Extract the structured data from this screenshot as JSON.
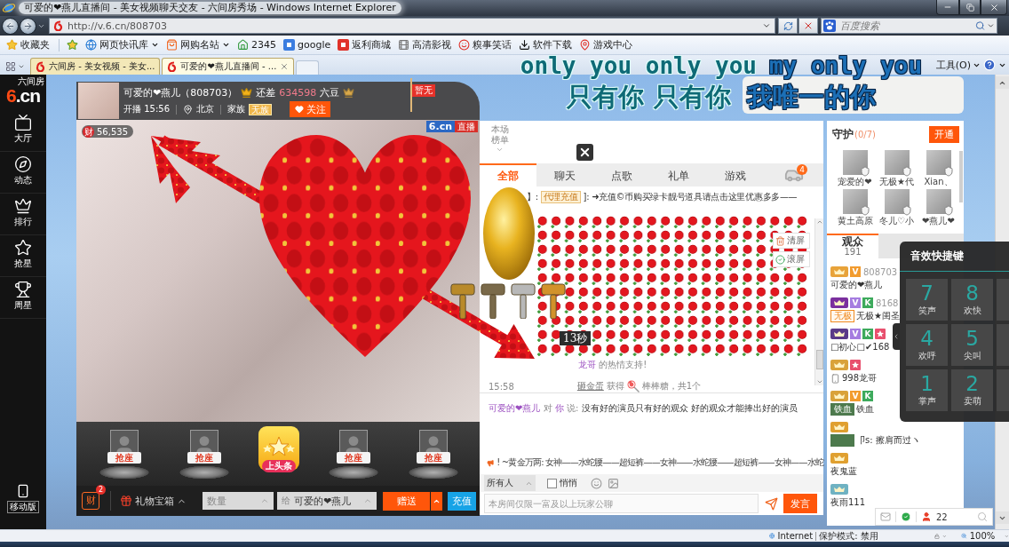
{
  "window": {
    "title": "可爱的❤燕儿直播间 - 美女视频聊天交友 - 六间房秀场 - Windows Internet Explorer"
  },
  "address_bar": {
    "url": "http://v.6.cn/808703"
  },
  "search_box": {
    "placeholder": "百度搜索"
  },
  "favorites_button": "收藏夹",
  "favorites": [
    {
      "label": "网页快讯库",
      "menu": true
    },
    {
      "label": "网购名站",
      "menu": true
    },
    {
      "label": "2345",
      "menu": false
    },
    {
      "label": "google",
      "menu": false
    },
    {
      "label": "返利商城",
      "menu": false
    },
    {
      "label": "高清影视",
      "menu": false
    },
    {
      "label": "糗事笑话",
      "menu": false
    },
    {
      "label": "软件下载",
      "menu": false
    },
    {
      "label": "游戏中心",
      "menu": false
    }
  ],
  "browser_tabs": [
    {
      "title": "六间房 - 美女视频 - 美女...",
      "selected": false
    },
    {
      "title": "可爱的❤燕儿直播间 - ...",
      "selected": true
    }
  ],
  "command_bar": {
    "tools": "工具(O)"
  },
  "lyrics": [
    {
      "parts": [
        {
          "text": "only you only you",
          "highlighted": false
        },
        {
          "text": "my only you",
          "highlighted": true
        }
      ]
    },
    {
      "parts": [
        {
          "text": "只有你 只有你",
          "highlighted": false
        },
        {
          "text": "我唯一的你",
          "highlighted": true
        }
      ]
    }
  ],
  "sidebar": {
    "logo": "6.cn",
    "logo_caption": "六间房",
    "items": [
      {
        "label": "大厅"
      },
      {
        "label": "动态"
      },
      {
        "label": "排行"
      },
      {
        "label": "抢星"
      },
      {
        "label": "周星"
      }
    ],
    "mobile": "移动版"
  },
  "anchor": {
    "name": "可爱的❤燕儿（808703）",
    "gap_label": "还差",
    "gap_value": "634598",
    "gap_unit": "六豆",
    "start": "开播 15:56",
    "city": "北京",
    "family_label": "家族",
    "family_tag": "无族",
    "follow": "关注",
    "flag": "暂无"
  },
  "video": {
    "wealth_mark": "财",
    "wealth": "56,535",
    "brand": "6.cn",
    "status": "直播"
  },
  "seats": [
    {
      "kind": "seat",
      "label": "抢座"
    },
    {
      "kind": "seat",
      "label": "抢座"
    },
    {
      "kind": "headline",
      "label": "上头条"
    },
    {
      "kind": "seat",
      "label": "抢座"
    },
    {
      "kind": "seat",
      "label": "抢座"
    }
  ],
  "gift_bar": {
    "wealth_mark": "财",
    "wealth_badge": "2",
    "gift_box": "礼物宝箱",
    "quantity_placeholder": "数量",
    "recipient_label": "给",
    "recipient": "可爱的❤燕儿",
    "send": "赠送",
    "recharge": "充值"
  },
  "gift_effect": {
    "countdown": "13秒"
  },
  "chat": {
    "ranking": "本场榜单",
    "tabs": [
      {
        "label": "全部",
        "selected": true
      },
      {
        "label": "聊天",
        "selected": false
      },
      {
        "label": "点歌",
        "selected": false
      },
      {
        "label": "礼单",
        "selected": false
      },
      {
        "label": "游戏",
        "selected": false
      }
    ],
    "car_badge": "4",
    "notice": {
      "prefix": "】:",
      "tag": "代理充值",
      "text": "]: ➜充值©币购买绿卡靓号道具请点击这里优惠多多——"
    },
    "screen_buttons": [
      {
        "label": "清屏"
      },
      {
        "label": "滚屏"
      }
    ],
    "thanks": {
      "user": "龙哥",
      "text": "的热情支持!"
    },
    "prize": {
      "time": "15:58",
      "action": "砸金蛋",
      "verb": "获得",
      "item": "棒棒糖，共1个"
    },
    "private_message": {
      "from": "可爱的❤燕儿",
      "to_word": "对",
      "to": "你",
      "say": "说:",
      "text": "没有好的演员只有好的观众 好的观众才能捧出好的演员"
    },
    "broadcast": "! ~黄金万两: 女神——水蛇腰——超短裤——女神——水蛇腰——超短裤——女神——水蛇"
  },
  "chat_input": {
    "audience": "所有人",
    "whisper": {
      "label": "悄悄",
      "checked": false
    },
    "placeholder": "本房间仅限一富及以上玩家公聊",
    "send": "发言"
  },
  "guard": {
    "title": "守护",
    "count": "(0/7)",
    "action": "开通",
    "members": [
      {
        "name": "宠爱的❤"
      },
      {
        "name": "无极★代"
      },
      {
        "name": "Xian、"
      },
      {
        "name": "黄土高原"
      },
      {
        "name": "冬儿♡小"
      },
      {
        "name": "❤燕儿❤"
      }
    ]
  },
  "audience_tabs": [
    {
      "label": "观众",
      "count": "191",
      "selected": true
    }
  ],
  "audience": [
    {
      "badges": [
        {
          "kind": "rank",
          "color": "#e8a33a"
        },
        {
          "kind": "letter",
          "label": "V",
          "color": "#f29b2e"
        }
      ],
      "id": "808703",
      "mobile": false,
      "name": "可爱的❤燕儿"
    },
    {
      "badges": [
        {
          "kind": "rank",
          "color": "#7b2f9e"
        },
        {
          "kind": "letter",
          "label": "V",
          "color": "#a57ce0"
        },
        {
          "kind": "letter",
          "label": "K",
          "color": "#3daa5c"
        }
      ],
      "id": "8168",
      "tag": {
        "kind": "outline",
        "label": "无极",
        "color": "#f08a20"
      },
      "mobile": false,
      "name": "无极★闺圣"
    },
    {
      "badges": [
        {
          "kind": "rank",
          "color": "#5a3a88"
        },
        {
          "kind": "letter",
          "label": "V",
          "color": "#a57ce0"
        },
        {
          "kind": "letter",
          "label": "K",
          "color": "#3daa5c"
        },
        {
          "kind": "star",
          "color": "#e8506e"
        }
      ],
      "mobile": false,
      "name": "□初心□✔168"
    },
    {
      "badges": [
        {
          "kind": "rank",
          "color": "#d9a23a"
        },
        {
          "kind": "star",
          "color": "#e8506e"
        }
      ],
      "mobile": true,
      "name": "998龙哥"
    },
    {
      "badges": [
        {
          "kind": "rank",
          "color": "#d9a23a"
        },
        {
          "kind": "letter",
          "label": "V",
          "color": "#f29b2e"
        },
        {
          "kind": "letter",
          "label": "K",
          "color": "#3daa5c"
        }
      ],
      "tag": {
        "kind": "solid",
        "label": "铁血",
        "color": "#4d7a4d"
      },
      "mobile": false,
      "name": "铁血"
    },
    {
      "badges": [
        {
          "kind": "rank",
          "color": "#e0a030"
        }
      ],
      "tag": {
        "kind": "solid",
        "color": "#4d7a4d"
      },
      "mobile": false,
      "name": "卩s: 擦肩而过ヽ"
    },
    {
      "badges": [
        {
          "kind": "rank",
          "color": "#e0a030"
        }
      ],
      "mobile": false,
      "name": "夜鬼蓝"
    },
    {
      "badges": [
        {
          "kind": "rank",
          "color": "#6fb2c2"
        }
      ],
      "mobile": false,
      "name": "夜雨111"
    }
  ],
  "sound_keys": {
    "title": "音效快捷键",
    "keys": [
      {
        "digit": "7",
        "label": "笑声"
      },
      {
        "digit": "8",
        "label": "欢快"
      },
      {
        "digit": "4",
        "label": "欢呼"
      },
      {
        "digit": "5",
        "label": "尖叫"
      },
      {
        "digit": "1",
        "label": "掌声"
      },
      {
        "digit": "2",
        "label": "卖萌"
      }
    ]
  },
  "room_toolbar": {
    "online": "22"
  },
  "status_bar": {
    "zone": "Internet",
    "protected_mode": "保护模式: 禁用",
    "zoom": "100%"
  }
}
